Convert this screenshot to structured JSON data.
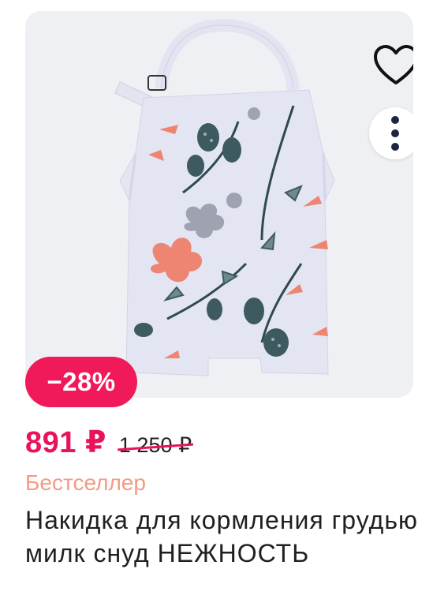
{
  "product": {
    "image_alt": "Накидка для кормления",
    "discount": "−28%",
    "price_current": "891 ₽",
    "price_old": "1 250 ₽",
    "badge": "Бестселлер",
    "title": "Накидка для кормления грудью милк снуд НЕЖНОСТЬ"
  },
  "icons": {
    "favorite": "heart-outline-icon",
    "more": "vertical-dots-icon"
  },
  "colors": {
    "accent": "#e8135a",
    "badge_bg": "#f0195a",
    "bestseller": "#f49a83",
    "image_bg": "#eef0f4"
  }
}
